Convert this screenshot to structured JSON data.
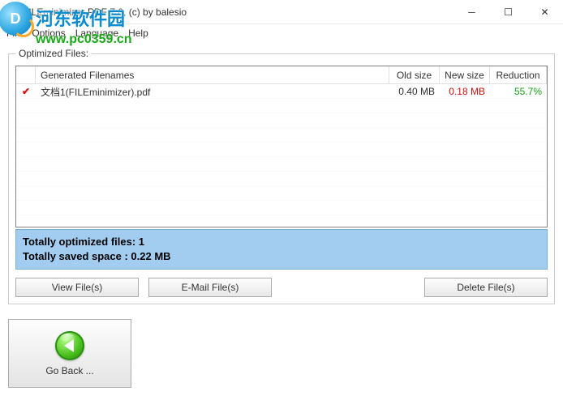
{
  "window": {
    "title": "FILEminimizer PDF 7.0, (c) by balesio"
  },
  "menu": {
    "file": "File",
    "options": "Options",
    "language": "Language",
    "help": "Help"
  },
  "watermark": {
    "name": "河东软件园",
    "url": "www.pc0359.cn"
  },
  "group": {
    "label": "Optimized Files:"
  },
  "columns": {
    "name": "Generated Filenames",
    "old": "Old size",
    "new": "New size",
    "red": "Reduction"
  },
  "rows": [
    {
      "filename": "文档1(FILEminimizer).pdf",
      "old": "0.40 MB",
      "new": "0.18 MB",
      "reduction": "55.7%"
    }
  ],
  "summary": {
    "line1": "Totally optimized files: 1",
    "line2": "Totally saved space  : 0.22 MB"
  },
  "buttons": {
    "view": "View File(s)",
    "email": "E-Mail File(s)",
    "delete": "Delete File(s)",
    "goback": "Go Back ..."
  }
}
